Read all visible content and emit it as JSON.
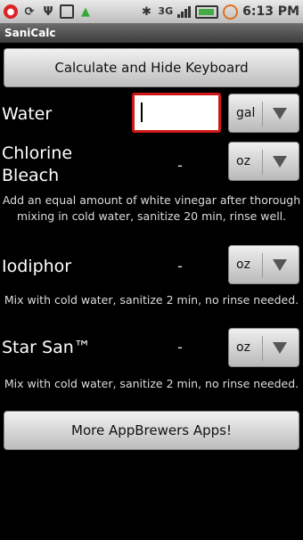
{
  "status_bar": {
    "network": "3G",
    "time": "6:13 PM",
    "icons": [
      "notification-icon",
      "sync-icon",
      "usb-icon",
      "photo-icon",
      "android-icon",
      "bluetooth-icon",
      "signal-icon",
      "battery-icon",
      "alarm-icon"
    ]
  },
  "app": {
    "title": "SaniCalc"
  },
  "calculate_button": "Calculate and Hide Keyboard",
  "water": {
    "label": "Water",
    "value": "",
    "unit": "gal"
  },
  "chlorine": {
    "label_line1": "Chlorine",
    "label_line2": "Bleach",
    "value": "-",
    "unit": "oz",
    "note": "Add an equal amount of white vinegar after thorough mixing in cold water, sanitize 20 min, rinse well."
  },
  "iodiphor": {
    "label": "Iodiphor",
    "value": "-",
    "unit": "oz",
    "note": "Mix with cold water, sanitize 2 min, no rinse needed."
  },
  "starsan": {
    "label": "Star San™",
    "value": "-",
    "unit": "oz",
    "note": "Mix with cold water, sanitize 2 min, no rinse needed."
  },
  "more_apps_button": "More AppBrewers Apps!",
  "colors": {
    "background": "#000000",
    "input_focus_border": "#d01818",
    "titlebar": "#4a4a4a"
  }
}
